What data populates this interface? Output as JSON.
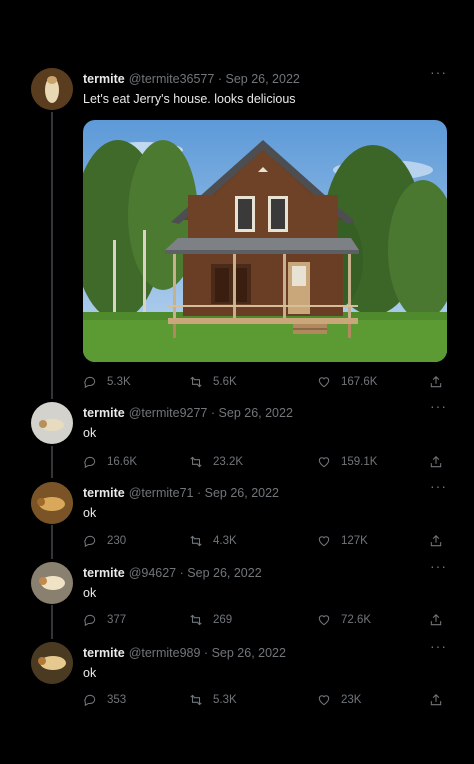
{
  "tweets": [
    {
      "name": "termite",
      "handle": "@termite36577",
      "date": "Sep 26, 2022",
      "text": "Let's eat Jerry's house. looks delicious",
      "replies": "5.3K",
      "retweets": "5.6K",
      "likes": "167.6K",
      "has_image": true
    },
    {
      "name": "termite",
      "handle": "@termite9277",
      "date": "Sep 26, 2022",
      "text": "ok",
      "replies": "16.6K",
      "retweets": "23.2K",
      "likes": "159.1K"
    },
    {
      "name": "termite",
      "handle": "@termite71",
      "date": "Sep 26, 2022",
      "text": "ok",
      "replies": "230",
      "retweets": "4.3K",
      "likes": "127K"
    },
    {
      "name": "termite",
      "handle": "@94627",
      "date": "Sep 26, 2022",
      "text": "ok",
      "replies": "377",
      "retweets": "269",
      "likes": "72.6K"
    },
    {
      "name": "termite",
      "handle": "@termite989",
      "date": "Sep 26, 2022",
      "text": "ok",
      "replies": "353",
      "retweets": "5.3K",
      "likes": "23K"
    }
  ],
  "separator": "·",
  "more_label": "···",
  "colors": {
    "background": "#000000",
    "text": "#e7e9ea",
    "muted": "#71767b",
    "thread_line": "#333639"
  }
}
